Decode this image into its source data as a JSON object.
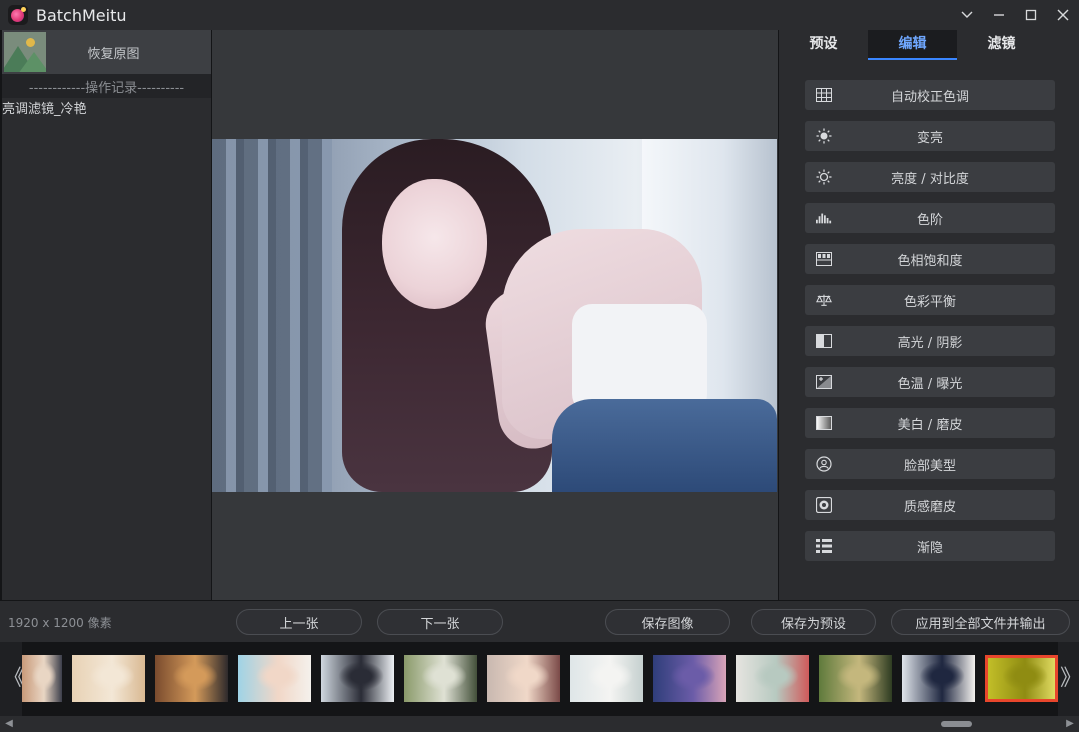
{
  "window": {
    "title": "BatchMeitu",
    "controls": [
      "chevron-down-icon",
      "minimize-icon",
      "maximize-icon",
      "close-icon"
    ]
  },
  "left_panel": {
    "restore_label": "恢复原图",
    "history_header": "------------操作记录----------",
    "history_items": [
      "亮调滤镜_冷艳"
    ]
  },
  "right_panel": {
    "tabs": [
      {
        "label": "预设",
        "active": false
      },
      {
        "label": "编辑",
        "active": true
      },
      {
        "label": "滤镜",
        "active": false
      }
    ],
    "tools": [
      {
        "label": "自动校正色调",
        "icon": "grid-icon"
      },
      {
        "label": "变亮",
        "icon": "sun-icon"
      },
      {
        "label": "亮度 / 对比度",
        "icon": "sun-outline-icon"
      },
      {
        "label": "色阶",
        "icon": "histogram-icon"
      },
      {
        "label": "色相饱和度",
        "icon": "palette-icon"
      },
      {
        "label": "色彩平衡",
        "icon": "scale-icon"
      },
      {
        "label": "高光 / 阴影",
        "icon": "half-square-icon"
      },
      {
        "label": "色温 / 曝光",
        "icon": "exposure-icon"
      },
      {
        "label": "美白 / 磨皮",
        "icon": "gradient-square-icon"
      },
      {
        "label": "脸部美型",
        "icon": "face-icon"
      },
      {
        "label": "质感磨皮",
        "icon": "texture-icon"
      },
      {
        "label": "渐隐",
        "icon": "list-icon"
      }
    ]
  },
  "bottom_bar": {
    "image_size": "1920 x 1200 像素",
    "prev_label": "上一张",
    "next_label": "下一张",
    "save_image_label": "保存图像",
    "save_preset_label": "保存为预设",
    "apply_all_label": "应用到全部文件并输出"
  },
  "filmstrip": {
    "left_arrow": "《",
    "right_arrow": "》",
    "thumbnails": [
      {
        "colors": [
          "#c89a7a",
          "#e9d6c4",
          "#3b3e4a"
        ],
        "selected": false
      },
      {
        "colors": [
          "#e8d2b5",
          "#f3e7d6",
          "#d9b992"
        ],
        "selected": false
      },
      {
        "colors": [
          "#7a4b2e",
          "#d49a5a",
          "#2e2a2c"
        ],
        "selected": false
      },
      {
        "colors": [
          "#9fd3e6",
          "#f1d7c7",
          "#f4f1ec"
        ],
        "selected": false
      },
      {
        "colors": [
          "#cfd7df",
          "#2a2c36",
          "#ecf0f4"
        ],
        "selected": false
      },
      {
        "colors": [
          "#8a9a6a",
          "#dfe1d4",
          "#43503a"
        ],
        "selected": false
      },
      {
        "colors": [
          "#c8b8b0",
          "#f0d8c8",
          "#7b4a48"
        ],
        "selected": false
      },
      {
        "colors": [
          "#dfe6e8",
          "#f4f4f2",
          "#c5d0cf"
        ],
        "selected": false
      },
      {
        "colors": [
          "#2f3e7a",
          "#6b5ca8",
          "#d9a4b8"
        ],
        "selected": false
      },
      {
        "colors": [
          "#e6e4e0",
          "#b7c9c0",
          "#d05a5a"
        ],
        "selected": false
      },
      {
        "colors": [
          "#5f7a3c",
          "#c4b77d",
          "#2e3c22"
        ],
        "selected": false
      },
      {
        "colors": [
          "#dfe4ea",
          "#1f2740",
          "#f3f1ee"
        ],
        "selected": false
      },
      {
        "colors": [
          "#c6c22a",
          "#8f8c12",
          "#e8e36a"
        ],
        "selected": true
      }
    ]
  }
}
